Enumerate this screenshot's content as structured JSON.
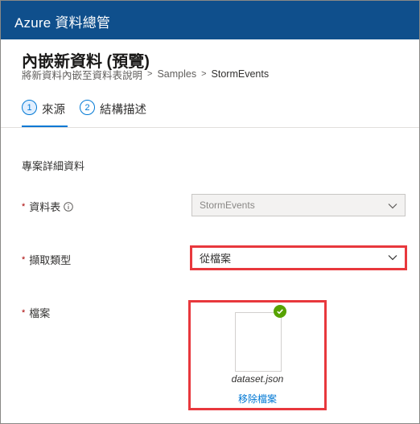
{
  "header": {
    "brand": "Azure 資料總管"
  },
  "page": {
    "title": "內嵌新資料 (預覽)"
  },
  "breadcrumb": [
    "將新資料內嵌至資料表說明",
    "Samples",
    "StormEvents"
  ],
  "tabs": [
    {
      "number": "1",
      "label": "來源"
    },
    {
      "number": "2",
      "label": "結構描述"
    }
  ],
  "section": {
    "title": "專案詳細資料"
  },
  "fields": {
    "table": {
      "label": "資料表",
      "value": "StormEvents"
    },
    "source_type": {
      "label": "擷取類型",
      "value": "從檔案"
    },
    "file": {
      "label": "檔案",
      "file_name": "dataset.json",
      "remove_label": "移除檔案"
    }
  },
  "required_marker": "*",
  "colors": {
    "brand_bar": "#0f4f8c",
    "accent": "#0078d4",
    "highlight": "#e8383d",
    "success": "#57a300",
    "required": "#a80000"
  },
  "icons": {
    "info": "info-icon",
    "chevron": "chevron-down-icon",
    "check": "checkmark-icon"
  }
}
